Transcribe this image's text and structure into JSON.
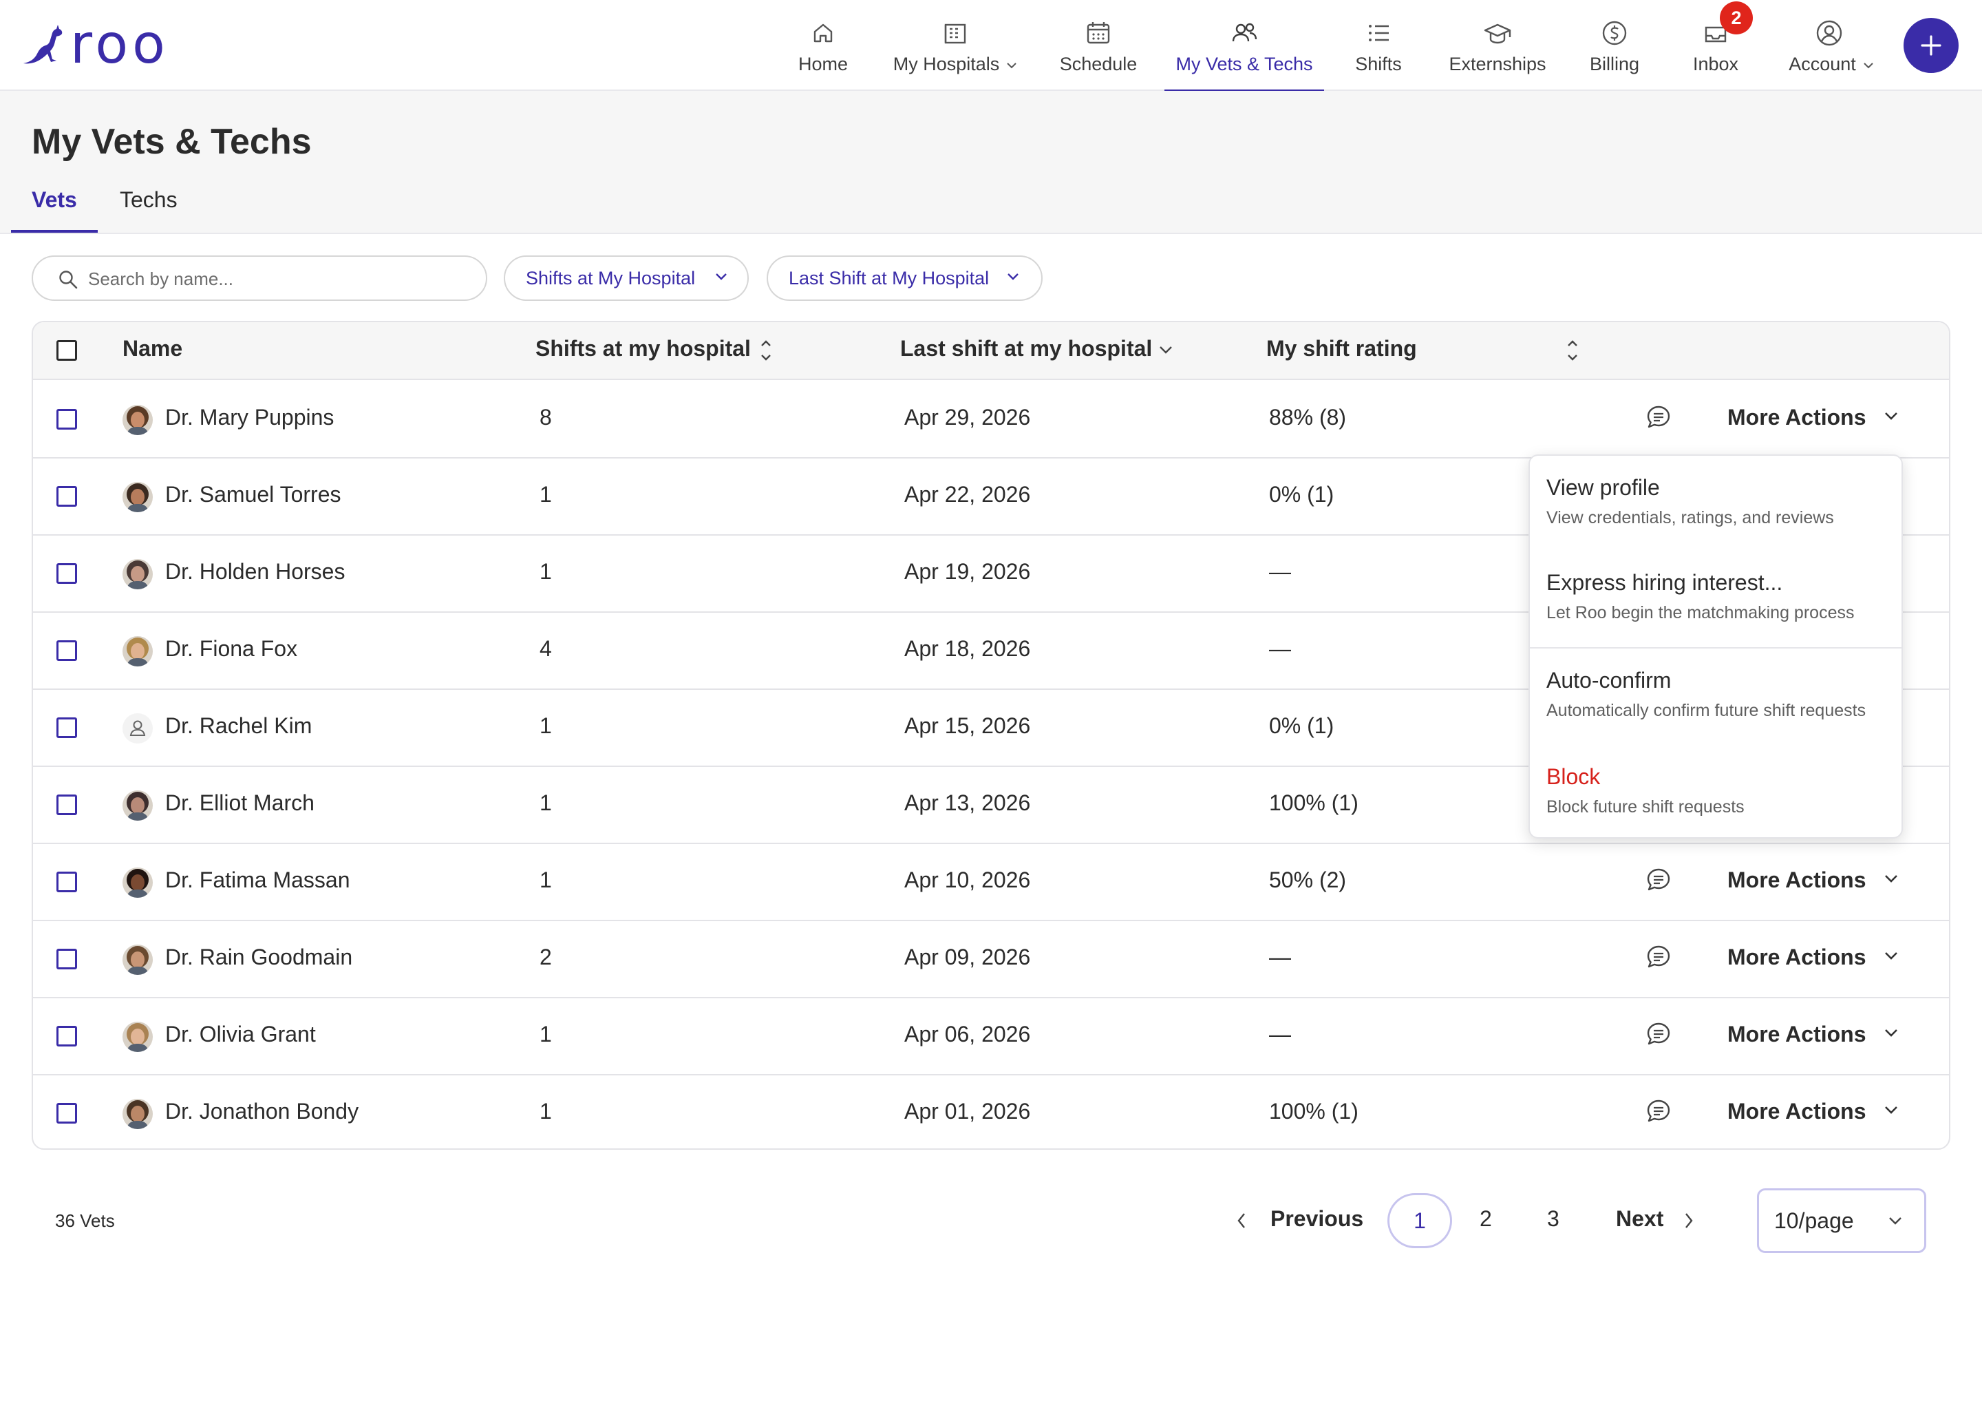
{
  "app": {
    "logo_text": "roo",
    "accent": "#3a2ca8",
    "danger": "#d6211b"
  },
  "nav": {
    "items": [
      {
        "label": "Home",
        "icon": "home-icon"
      },
      {
        "label": "My Hospitals",
        "icon": "building-icon",
        "has_caret": true
      },
      {
        "label": "Schedule",
        "icon": "calendar-icon"
      },
      {
        "label": "My Vets & Techs",
        "icon": "people-icon",
        "active": true
      },
      {
        "label": "Shifts",
        "icon": "list-icon"
      },
      {
        "label": "Externships",
        "icon": "graduation-cap-icon"
      },
      {
        "label": "Billing",
        "icon": "dollar-icon"
      },
      {
        "label": "Inbox",
        "icon": "inbox-icon",
        "badge": "2"
      },
      {
        "label": "Account",
        "icon": "user-circle-icon",
        "has_caret": true
      }
    ],
    "fab_icon": "plus-icon"
  },
  "page": {
    "title": "My Vets & Techs",
    "tabs": [
      "Vets",
      "Techs"
    ],
    "active_tab": "Vets"
  },
  "filters": {
    "search_placeholder": "Search by name...",
    "shifts_filter": "Shifts at My Hospital",
    "last_shift_filter": "Last Shift at My Hospital"
  },
  "table": {
    "columns": [
      "Name",
      "Shifts at my hospital",
      "Last shift at my hospital",
      "My shift rating"
    ],
    "rows": [
      {
        "name": "Dr. Mary Puppins",
        "shifts": "8",
        "last_shift": "Apr 29, 2026",
        "rating": "88% (8)",
        "avatar_skin": "#c98d6b",
        "avatar_hair": "#5a3b26"
      },
      {
        "name": "Dr. Samuel Torres",
        "shifts": "1",
        "last_shift": "Apr 22, 2026",
        "rating": "0% (1)",
        "avatar_skin": "#b77c5c",
        "avatar_hair": "#3b2a20"
      },
      {
        "name": "Dr. Holden Horses",
        "shifts": "1",
        "last_shift": "Apr 19, 2026",
        "rating": "—",
        "avatar_skin": "#c69a86",
        "avatar_hair": "#4a3a36"
      },
      {
        "name": "Dr. Fiona Fox",
        "shifts": "4",
        "last_shift": "Apr 18, 2026",
        "rating": "—",
        "avatar_skin": "#e0b290",
        "avatar_hair": "#b08a4c"
      },
      {
        "name": "Dr. Rachel Kim",
        "shifts": "1",
        "last_shift": "Apr 15, 2026",
        "rating": "0% (1)",
        "avatar_placeholder": true
      },
      {
        "name": "Dr. Elliot March",
        "shifts": "1",
        "last_shift": "Apr 13, 2026",
        "rating": "100% (1)",
        "avatar_skin": "#b88a78",
        "avatar_hair": "#3d2e2e"
      },
      {
        "name": "Dr. Fatima Massan",
        "shifts": "1",
        "last_shift": "Apr 10, 2026",
        "rating": "50% (2)",
        "avatar_skin": "#7a4a32",
        "avatar_hair": "#1f1410"
      },
      {
        "name": "Dr. Rain Goodmain",
        "shifts": "2",
        "last_shift": "Apr 09, 2026",
        "rating": "—",
        "avatar_skin": "#c99676",
        "avatar_hair": "#6a4a30"
      },
      {
        "name": "Dr. Olivia Grant",
        "shifts": "1",
        "last_shift": "Apr 06, 2026",
        "rating": "—",
        "avatar_skin": "#e1b596",
        "avatar_hair": "#a98253"
      },
      {
        "name": "Dr. Jonathon Bondy",
        "shifts": "1",
        "last_shift": "Apr 01, 2026",
        "rating": "100% (1)",
        "avatar_skin": "#bb8767",
        "avatar_hair": "#4a3424"
      }
    ],
    "more_actions_label": "More Actions"
  },
  "dropdown": {
    "items": [
      {
        "title": "View profile",
        "subtitle": "View credentials, ratings, and reviews"
      },
      {
        "title": "Express hiring interest...",
        "subtitle": "Let Roo begin the matchmaking process"
      },
      {
        "title": "Auto-confirm",
        "subtitle": "Automatically confirm future shift requests"
      },
      {
        "title": "Block",
        "subtitle": "Block future shift requests",
        "danger": true
      }
    ]
  },
  "pagination": {
    "count_label": "36 Vets",
    "previous": "Previous",
    "pages": [
      "1",
      "2",
      "3"
    ],
    "current_page": "1",
    "next": "Next",
    "page_size": "10/page"
  }
}
